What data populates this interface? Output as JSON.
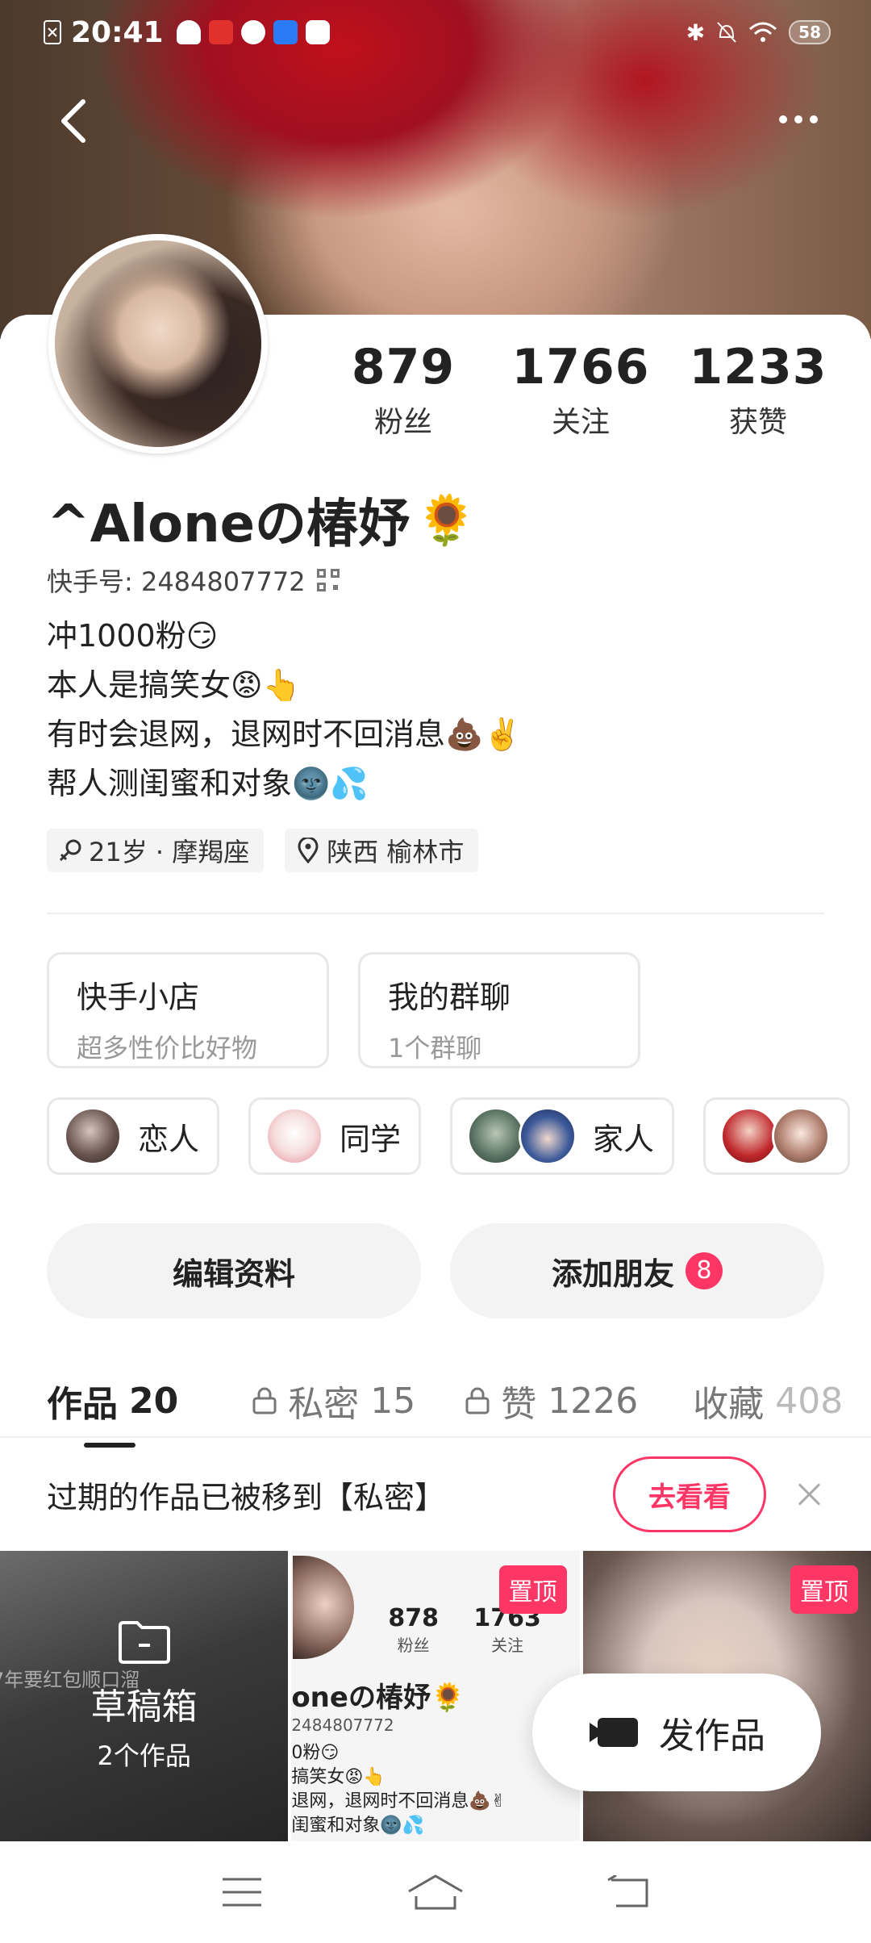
{
  "status_bar": {
    "time": "20:41",
    "battery": "58"
  },
  "profile": {
    "stats": [
      {
        "value": "879",
        "label": "粉丝"
      },
      {
        "value": "1766",
        "label": "关注"
      },
      {
        "value": "1233",
        "label": "获赞"
      }
    ],
    "name": "^Aloneの椿妤",
    "name_emoji": "🌻",
    "id_line": "快手号: 2484807772",
    "bio": [
      "冲1000粉😏",
      "本人是搞笑女😡👆",
      "有时会退网，退网时不回消息💩✌️",
      "帮人测闺蜜和对象🌚💦"
    ],
    "tags": [
      {
        "icon": "gender-icon",
        "text": "21岁 · 摩羯座"
      },
      {
        "icon": "location-icon",
        "text": "陕西 榆林市"
      }
    ]
  },
  "features": [
    {
      "title": "快手小店",
      "subtitle": "超多性价比好物"
    },
    {
      "title": "我的群聊",
      "subtitle": "1个群聊"
    }
  ],
  "groups": [
    {
      "label": "恋人"
    },
    {
      "label": "同学"
    },
    {
      "label": "家人"
    },
    {
      "label": ""
    }
  ],
  "actions": {
    "edit": "编辑资料",
    "add_friends": "添加朋友",
    "add_friends_badge": "8"
  },
  "tabs": [
    {
      "label": "作品",
      "count": "20",
      "locked": false
    },
    {
      "label": "私密",
      "count": "15",
      "locked": true
    },
    {
      "label": "赞",
      "count": "1226",
      "locked": true
    },
    {
      "label": "收藏",
      "count": "408",
      "locked": false
    }
  ],
  "notice": {
    "text": "过期的作品已被移到【私密】",
    "button": "去看看"
  },
  "grid": {
    "draft": {
      "title": "草稿箱",
      "count": "2个作品",
      "bg_text": "7年要红包顺口溜"
    },
    "pin_label": "置顶",
    "mini_profile": {
      "stats": [
        {
          "value": "878",
          "label": "粉丝"
        },
        {
          "value": "1763",
          "label": "关注"
        }
      ],
      "name": "oneの椿妤🌻",
      "id": "2484807772",
      "lines": [
        "0粉😏",
        "搞笑女😡👆",
        "退网，退网时不回消息💩✌",
        "闺蜜和对象🌚💦"
      ]
    }
  },
  "fab": {
    "label": "发作品"
  },
  "colors": {
    "accent": "#fe3666"
  }
}
